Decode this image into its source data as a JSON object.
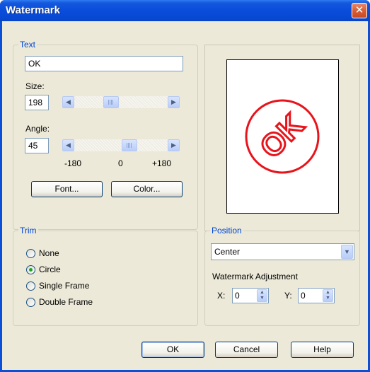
{
  "window": {
    "title": "Watermark",
    "close_symbol": "✕"
  },
  "text_group": {
    "legend": "Text",
    "text_value": "OK",
    "size_label": "Size:",
    "size_value": "198",
    "angle_label": "Angle:",
    "angle_value": "45",
    "angle_scale": {
      "min": "-180",
      "mid": "0",
      "max": "+180"
    },
    "font_button": "Font...",
    "color_button": "Color..."
  },
  "preview": {
    "stamp_text": "OK",
    "stamp_color": "#e8141c"
  },
  "trim": {
    "legend": "Trim",
    "options": [
      {
        "label": "None",
        "selected": false
      },
      {
        "label": "Circle",
        "selected": true
      },
      {
        "label": "Single Frame",
        "selected": false
      },
      {
        "label": "Double Frame",
        "selected": false
      }
    ]
  },
  "position": {
    "legend": "Position",
    "selected": "Center",
    "adjustment_label": "Watermark Adjustment",
    "x_label": "X:",
    "x_value": "0",
    "y_label": "Y:",
    "y_value": "0"
  },
  "buttons": {
    "ok": "OK",
    "cancel": "Cancel",
    "help": "Help"
  },
  "colors": {
    "title_bar": "#0a4fd6",
    "dialog_bg": "#ece9d8",
    "legend_text": "#0046d5"
  },
  "icons": {
    "scroll_left": "◀",
    "scroll_right": "▶",
    "dropdown": "▼",
    "spin_up": "▲",
    "spin_down": "▼"
  }
}
